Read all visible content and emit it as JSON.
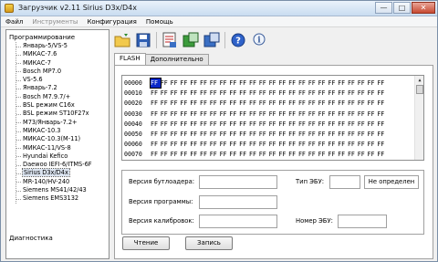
{
  "window": {
    "title": "Загрузчик v2.11 Sirius D3x/D4x",
    "controls": {
      "minimize": "—",
      "maximize": "□",
      "close": "✕"
    }
  },
  "menu": [
    "Файл",
    "Инструменты",
    "Конфигурация",
    "Помощь"
  ],
  "toolbar": {
    "icons": [
      "open-folder-icon",
      "save-icon",
      "report-icon",
      "ecu-read-icon",
      "ecu-write-icon",
      "help-icon",
      "info-icon"
    ]
  },
  "sidebar": {
    "root": "Программирование",
    "items": [
      "Январь-5/VS-5",
      "МИКАС-7.6",
      "МИКАС-7",
      "Bosch MP7.0",
      "VS-5.6",
      "Январь-7.2",
      "Bosch M7.9.7/+",
      "BSL режим C16x",
      "BSL режим ST10F27x",
      "M73/Январь-7.2+",
      "МИКАС-10.3",
      "МИКАС-10.3(M-11)",
      "МИКАС-11/VS-8",
      "Hyundai Kefico",
      "Daewoo IEFI-6/ITMS-6F",
      "Sirius D3x/D4x",
      "MR-140/HV-240",
      "Siemens MS41/42/43",
      "Siemens EMS3132"
    ],
    "selected_index": 15,
    "diag": "Диагностика"
  },
  "tabs": [
    "FLASH",
    "Дополнительно"
  ],
  "hex": {
    "rows": [
      {
        "addr": "00000",
        "bytes": [
          "FF",
          "FF",
          "FF",
          "FF",
          "FF",
          "FF",
          "FF",
          "FF",
          "FF",
          "FF",
          "FF",
          "FF",
          "FF",
          "FF",
          "FF",
          "FF",
          "FF",
          "FF",
          "FF",
          "FF",
          "FF",
          "FF",
          "FF",
          "FF"
        ]
      },
      {
        "addr": "00010",
        "bytes": [
          "FF",
          "FF",
          "FF",
          "FF",
          "FF",
          "FF",
          "FF",
          "FF",
          "FF",
          "FF",
          "FF",
          "FF",
          "FF",
          "FF",
          "FF",
          "FF",
          "FF",
          "FF",
          "FF",
          "FF",
          "FF",
          "FF",
          "FF",
          "FF"
        ]
      },
      {
        "addr": "00020",
        "bytes": [
          "FF",
          "FF",
          "FF",
          "FF",
          "FF",
          "FF",
          "FF",
          "FF",
          "FF",
          "FF",
          "FF",
          "FF",
          "FF",
          "FF",
          "FF",
          "FF",
          "FF",
          "FF",
          "FF",
          "FF",
          "FF",
          "FF",
          "FF",
          "FF"
        ]
      },
      {
        "addr": "00030",
        "bytes": [
          "FF",
          "FF",
          "FF",
          "FF",
          "FF",
          "FF",
          "FF",
          "FF",
          "FF",
          "FF",
          "FF",
          "FF",
          "FF",
          "FF",
          "FF",
          "FF",
          "FF",
          "FF",
          "FF",
          "FF",
          "FF",
          "FF",
          "FF",
          "FF"
        ]
      },
      {
        "addr": "00040",
        "bytes": [
          "FF",
          "FF",
          "FF",
          "FF",
          "FF",
          "FF",
          "FF",
          "FF",
          "FF",
          "FF",
          "FF",
          "FF",
          "FF",
          "FF",
          "FF",
          "FF",
          "FF",
          "FF",
          "FF",
          "FF",
          "FF",
          "FF",
          "FF",
          "FF"
        ]
      },
      {
        "addr": "00050",
        "bytes": [
          "FF",
          "FF",
          "FF",
          "FF",
          "FF",
          "FF",
          "FF",
          "FF",
          "FF",
          "FF",
          "FF",
          "FF",
          "FF",
          "FF",
          "FF",
          "FF",
          "FF",
          "FF",
          "FF",
          "FF",
          "FF",
          "FF",
          "FF",
          "FF"
        ]
      },
      {
        "addr": "00060",
        "bytes": [
          "FF",
          "FF",
          "FF",
          "FF",
          "FF",
          "FF",
          "FF",
          "FF",
          "FF",
          "FF",
          "FF",
          "FF",
          "FF",
          "FF",
          "FF",
          "FF",
          "FF",
          "FF",
          "FF",
          "FF",
          "FF",
          "FF",
          "FF",
          "FF"
        ]
      },
      {
        "addr": "00070",
        "bytes": [
          "FF",
          "FF",
          "FF",
          "FF",
          "FF",
          "FF",
          "FF",
          "FF",
          "FF",
          "FF",
          "FF",
          "FF",
          "FF",
          "FF",
          "FF",
          "FF",
          "FF",
          "FF",
          "FF",
          "FF",
          "FF",
          "FF",
          "FF",
          "FF"
        ]
      }
    ],
    "selected_byte": 0
  },
  "info": {
    "bootloader_label": "Версия бутлоадера:",
    "bootloader_value": "",
    "program_label": "Версия программы:",
    "program_value": "",
    "calib_label": "Версия калибровок:",
    "calib_value": "",
    "ecu_type_label": "Тип ЭБУ:",
    "ecu_type_value": "",
    "ecu_status": "Не определен",
    "ecu_number_label": "Номер ЭБУ:",
    "ecu_number_value": ""
  },
  "buttons": {
    "read": "Чтение",
    "write": "Запись"
  },
  "colors": {
    "selection": "#0a28c8",
    "title_gradient": "#c9dcf0"
  }
}
